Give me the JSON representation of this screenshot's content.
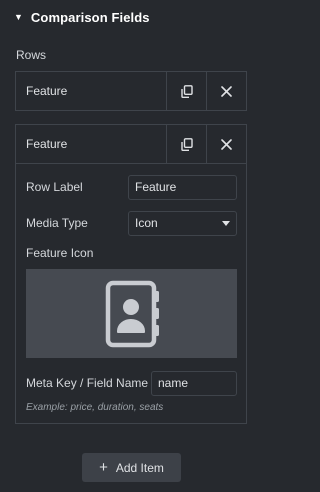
{
  "section": {
    "title": "Comparison Fields",
    "caret_icon": "caret-down-icon"
  },
  "rows_label": "Rows",
  "rows": [
    {
      "title": "Feature",
      "expanded": false
    },
    {
      "title": "Feature",
      "expanded": true,
      "fields": {
        "row_label": {
          "label": "Row Label",
          "value": "Feature"
        },
        "media_type": {
          "label": "Media Type",
          "value": "Icon"
        },
        "feature_icon": {
          "label": "Feature Icon",
          "icon": "contact-book-icon"
        },
        "meta_key": {
          "label": "Meta Key / Field Name",
          "value": "name"
        },
        "hint": "Example: price, duration, seats"
      }
    }
  ],
  "add_item_label": "Add Item",
  "colors": {
    "background": "#26292e",
    "border": "#3f444b",
    "media_bg": "#464a51",
    "icon": "#c9ccd1",
    "button_bg": "#3d4148"
  }
}
